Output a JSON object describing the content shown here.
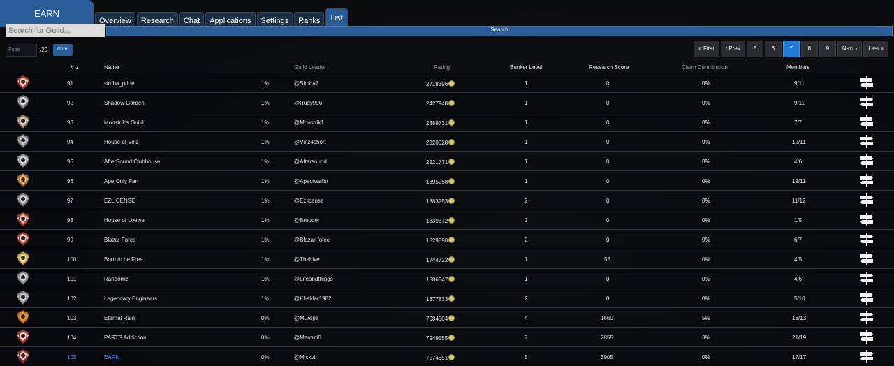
{
  "header": {
    "earn_label": "EARN",
    "tabs": [
      "Overview",
      "Research",
      "Chat",
      "Applications",
      "Settings",
      "Ranks",
      "List"
    ],
    "active_tab": "List"
  },
  "search": {
    "placeholder": "Search for Guild...",
    "button_label": "Search"
  },
  "pagination": {
    "page_placeholder": "Page",
    "total_pages": "/29",
    "goto_label": "Go To",
    "buttons": [
      "« First",
      "‹ Prev",
      "5",
      "6",
      "7",
      "8",
      "9",
      "Next ›",
      "Last »"
    ],
    "current_page": "7"
  },
  "table": {
    "headers": {
      "num": "#",
      "name": "Name",
      "leader": "Guild Leader",
      "rating": "Rating",
      "bunker": "Bunker Level",
      "research": "Research Score",
      "claim": "Claim Contribution",
      "members": "Members"
    },
    "rows": [
      {
        "num": "91",
        "name": "simba_pride",
        "pct": "1%",
        "leader": "@Simba7",
        "rating": "2718396",
        "bunker": "1",
        "research": "0",
        "claim": "0%",
        "members": "9/11"
      },
      {
        "num": "92",
        "name": "Shadow Garden",
        "pct": "1%",
        "leader": "@Rudy996",
        "rating": "2427948",
        "bunker": "1",
        "research": "0",
        "claim": "0%",
        "members": "9/11"
      },
      {
        "num": "93",
        "name": "Monstrik's Guild",
        "pct": "1%",
        "leader": "@Monstrik1",
        "rating": "2389731",
        "bunker": "1",
        "research": "0",
        "claim": "0%",
        "members": "7/7"
      },
      {
        "num": "94",
        "name": "House of Vinz",
        "pct": "1%",
        "leader": "@Vinz4short",
        "rating": "2320028",
        "bunker": "1",
        "research": "0",
        "claim": "0%",
        "members": "12/11"
      },
      {
        "num": "95",
        "name": "AfterSound Clubhouse",
        "pct": "1%",
        "leader": "@Aftersound",
        "rating": "2221771",
        "bunker": "1",
        "research": "0",
        "claim": "0%",
        "members": "4/6"
      },
      {
        "num": "96",
        "name": "Ape Only Fan",
        "pct": "1%",
        "leader": "@Apeofwallst",
        "rating": "1895258",
        "bunker": "1",
        "research": "0",
        "claim": "0%",
        "members": "12/11"
      },
      {
        "num": "97",
        "name": "EZLICENSE",
        "pct": "1%",
        "leader": "@Ezlicense",
        "rating": "1883253",
        "bunker": "2",
        "research": "0",
        "claim": "0%",
        "members": "11/12"
      },
      {
        "num": "98",
        "name": "House of Loewe",
        "pct": "1%",
        "leader": "@Brooder",
        "rating": "1839372",
        "bunker": "2",
        "research": "0",
        "claim": "0%",
        "members": "1/5"
      },
      {
        "num": "99",
        "name": "Blazar Force",
        "pct": "1%",
        "leader": "@Blazar-force",
        "rating": "1829898",
        "bunker": "2",
        "research": "0",
        "claim": "0%",
        "members": "6/7"
      },
      {
        "num": "100",
        "name": "Born to be Free",
        "pct": "1%",
        "leader": "@Thehive",
        "rating": "1744722",
        "bunker": "1",
        "research": "55",
        "claim": "0%",
        "members": "4/5"
      },
      {
        "num": "101",
        "name": "Randomz",
        "pct": "1%",
        "leader": "@Lifeandthings",
        "rating": "1586547",
        "bunker": "1",
        "research": "0",
        "claim": "0%",
        "members": "4/6"
      },
      {
        "num": "102",
        "name": "Legendary Engineers",
        "pct": "1%",
        "leader": "@Kheldar1982",
        "rating": "1377833",
        "bunker": "2",
        "research": "0",
        "claim": "0%",
        "members": "5/10"
      },
      {
        "num": "103",
        "name": "Eternal Rain",
        "pct": "0%",
        "leader": "@Murepa",
        "rating": "7984504",
        "bunker": "4",
        "research": "1660",
        "claim": "5%",
        "members": "13/13"
      },
      {
        "num": "104",
        "name": "PARTS Addiction",
        "pct": "0%",
        "leader": "@Mercuti0",
        "rating": "7949555",
        "bunker": "7",
        "research": "2855",
        "claim": "3%",
        "members": "21/19"
      },
      {
        "num": "105",
        "name": "EARN",
        "pct": "0%",
        "leader": "@Mickvir",
        "rating": "7574651",
        "bunker": "5",
        "research": "3905",
        "claim": "0%",
        "members": "17/17",
        "highlight": true
      }
    ]
  },
  "colors": {
    "accent": "#2a5d98",
    "active_page": "#1f7ad8",
    "highlight_text": "#3f8ff0"
  }
}
